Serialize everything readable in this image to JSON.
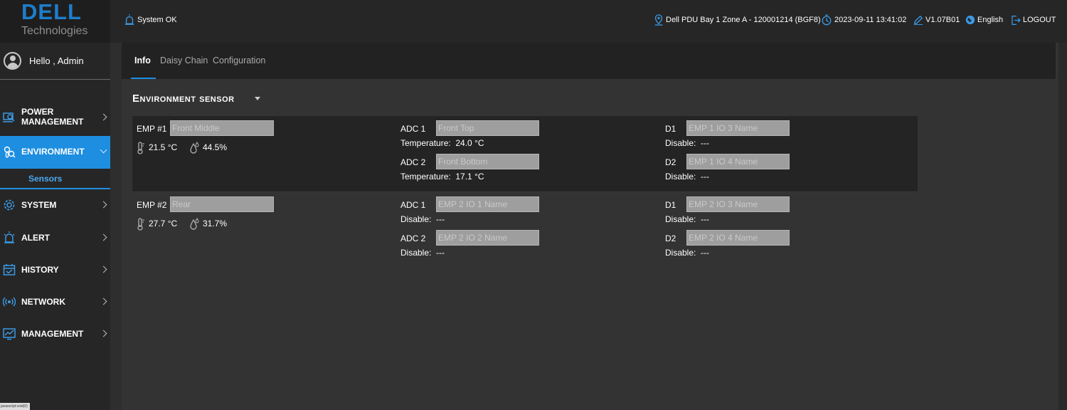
{
  "brand": {
    "name": "DELL",
    "sub": "Technologies"
  },
  "user": {
    "greeting": "Hello , Admin"
  },
  "nav": {
    "items": [
      {
        "label_line1": "POWER",
        "label_line2": "MANAGEMENT",
        "icon": "power-management-icon"
      },
      {
        "label": "ENVIRONMENT",
        "icon": "environment-icon"
      },
      {
        "label": "SYSTEM",
        "icon": "gear-icon"
      },
      {
        "label": "ALERT",
        "icon": "alarm-icon"
      },
      {
        "label": "HISTORY",
        "icon": "calendar-icon"
      },
      {
        "label": "NETWORK",
        "icon": "network-icon"
      },
      {
        "label": "MANAGEMENT",
        "icon": "monitor-icon"
      }
    ],
    "sub_active": "Sensors"
  },
  "status_bar_text": "javascript:void(0)",
  "topbar": {
    "system_status": "System OK",
    "location": "Dell PDU Bay 1 Zone A - 120001214 (BGF8)",
    "datetime": "2023-09-11 13:41:02",
    "version": "V1.07B01",
    "language": "English",
    "logout": "LOGOUT"
  },
  "tabs": [
    "Info",
    "Daisy Chain",
    "Configuration"
  ],
  "section_title": "Environment sensor",
  "emp": [
    {
      "label": "EMP #1",
      "name": "Front Middle",
      "temperature": "21.5 °C",
      "humidity": "44.5%",
      "adc": [
        {
          "label": "ADC 1",
          "name": "Front Top",
          "sub_label": "Temperature:",
          "sub_value": "24.0 °C"
        },
        {
          "label": "ADC 2",
          "name": "Front Bottom",
          "sub_label": "Temperature:",
          "sub_value": "17.1 °C"
        }
      ],
      "dio": [
        {
          "label": "D1",
          "name": "EMP 1 IO 3 Name",
          "sub_label": "Disable:",
          "sub_value": "---"
        },
        {
          "label": "D2",
          "name": "EMP 1 IO 4 Name",
          "sub_label": "Disable:",
          "sub_value": "---"
        }
      ]
    },
    {
      "label": "EMP #2",
      "name": "Rear",
      "temperature": "27.7 °C",
      "humidity": "31.7%",
      "adc": [
        {
          "label": "ADC 1",
          "name": "EMP 2 IO 1 Name",
          "sub_label": "Disable:",
          "sub_value": "---"
        },
        {
          "label": "ADC 2",
          "name": "EMP 2 IO 2 Name",
          "sub_label": "Disable:",
          "sub_value": "---"
        }
      ],
      "dio": [
        {
          "label": "D1",
          "name": "EMP 2 IO 3 Name",
          "sub_label": "Disable:",
          "sub_value": "---"
        },
        {
          "label": "D2",
          "name": "EMP 2 IO 4 Name",
          "sub_label": "Disable:",
          "sub_value": "---"
        }
      ]
    }
  ],
  "colors": {
    "accent": "#1d8ee0",
    "brand": "#1d7ecb",
    "background": "#2e2e2e"
  }
}
